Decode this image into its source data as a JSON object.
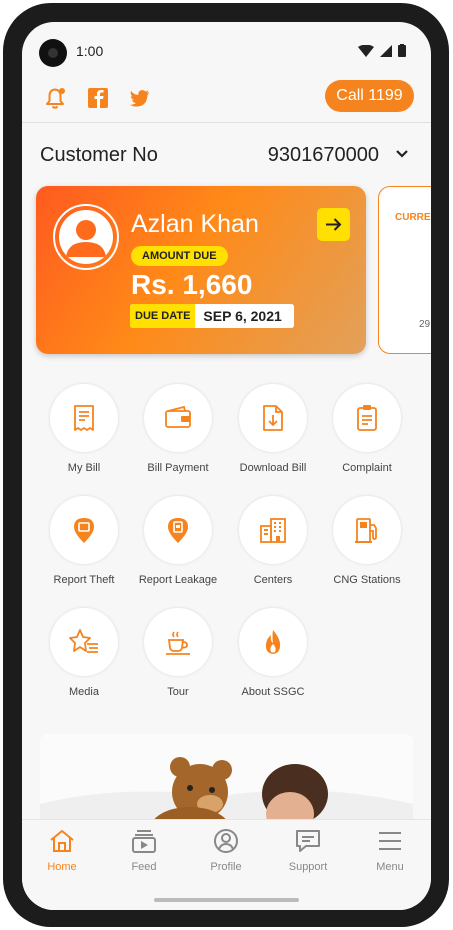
{
  "status": {
    "time": "1:00"
  },
  "topbar": {
    "icons": [
      "bell-icon",
      "facebook-icon",
      "twitter-icon"
    ],
    "call_label": "Call 1199"
  },
  "customer": {
    "label": "Customer No",
    "number": "9301670000"
  },
  "bill_card": {
    "name": "Azlan Khan",
    "amount_badge": "AMOUNT DUE",
    "amount": "Rs. 1,660",
    "due_label": "DUE DATE",
    "due_date": "SEP 6, 2021"
  },
  "second_card": {
    "title": "CURRE",
    "value": "29"
  },
  "services": [
    {
      "label": "My Bill",
      "icon": "receipt-icon"
    },
    {
      "label": "Bill Payment",
      "icon": "wallet-icon"
    },
    {
      "label": "Download Bill",
      "icon": "download-document-icon"
    },
    {
      "label": "Complaint",
      "icon": "clipboard-icon"
    },
    {
      "label": "Report Theft",
      "icon": "theft-pin-icon"
    },
    {
      "label": "Report Leakage",
      "icon": "leakage-pin-icon"
    },
    {
      "label": "Centers",
      "icon": "buildings-icon"
    },
    {
      "label": "CNG Stations",
      "icon": "fuel-pump-icon"
    },
    {
      "label": "Media",
      "icon": "star-list-icon"
    },
    {
      "label": "Tour",
      "icon": "cup-icon"
    },
    {
      "label": "About SSGC",
      "icon": "flame-icon"
    }
  ],
  "nav": {
    "items": [
      {
        "label": "Home",
        "icon": "home-icon",
        "active": true
      },
      {
        "label": "Feed",
        "icon": "feed-icon",
        "active": false
      },
      {
        "label": "Profile",
        "icon": "profile-icon",
        "active": false
      },
      {
        "label": "Support",
        "icon": "chat-icon",
        "active": false
      },
      {
        "label": "Menu",
        "icon": "hamburger-icon",
        "active": false
      }
    ]
  },
  "colors": {
    "accent": "#f5841f",
    "badge": "#ffe000"
  }
}
